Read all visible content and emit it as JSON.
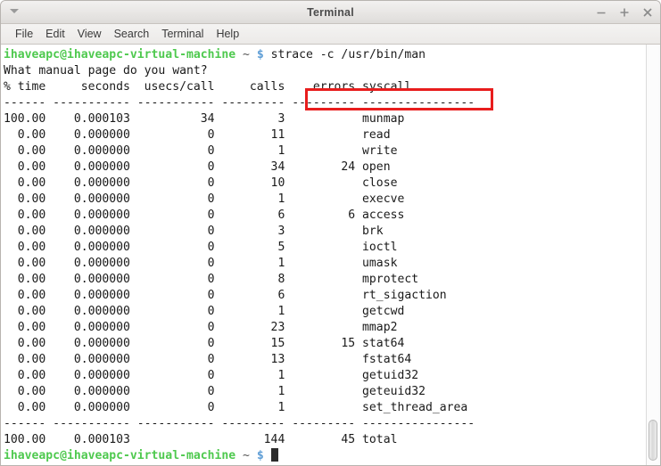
{
  "window": {
    "title": "Terminal",
    "controls": {
      "minimize": "minimize",
      "maximize": "maximize",
      "close": "close"
    }
  },
  "menubar": {
    "items": [
      {
        "label": "File"
      },
      {
        "label": "Edit"
      },
      {
        "label": "View"
      },
      {
        "label": "Search"
      },
      {
        "label": "Terminal"
      },
      {
        "label": "Help"
      }
    ]
  },
  "terminal": {
    "prompt": {
      "user_host": "ihaveapc@ihaveapc-virtual-machine",
      "path": "~",
      "symbol": "$"
    },
    "command": "strace -c /usr/bin/man",
    "command_highlight_color": "#e81d1d",
    "output_first_line": "What manual page do you want?",
    "columns": {
      "header": "% time     seconds  usecs/call     calls    errors syscall",
      "separator": "------ ----------- ----------- --------- --------- ----------------",
      "names": [
        "% time",
        "seconds",
        "usecs/call",
        "calls",
        "errors",
        "syscall"
      ]
    },
    "rows": [
      {
        "time": "100.00",
        "seconds": "0.000103",
        "usecs": "34",
        "calls": "3",
        "errors": "",
        "syscall": "munmap"
      },
      {
        "time": "0.00",
        "seconds": "0.000000",
        "usecs": "0",
        "calls": "11",
        "errors": "",
        "syscall": "read"
      },
      {
        "time": "0.00",
        "seconds": "0.000000",
        "usecs": "0",
        "calls": "1",
        "errors": "",
        "syscall": "write"
      },
      {
        "time": "0.00",
        "seconds": "0.000000",
        "usecs": "0",
        "calls": "34",
        "errors": "24",
        "syscall": "open"
      },
      {
        "time": "0.00",
        "seconds": "0.000000",
        "usecs": "0",
        "calls": "10",
        "errors": "",
        "syscall": "close"
      },
      {
        "time": "0.00",
        "seconds": "0.000000",
        "usecs": "0",
        "calls": "1",
        "errors": "",
        "syscall": "execve"
      },
      {
        "time": "0.00",
        "seconds": "0.000000",
        "usecs": "0",
        "calls": "6",
        "errors": "6",
        "syscall": "access"
      },
      {
        "time": "0.00",
        "seconds": "0.000000",
        "usecs": "0",
        "calls": "3",
        "errors": "",
        "syscall": "brk"
      },
      {
        "time": "0.00",
        "seconds": "0.000000",
        "usecs": "0",
        "calls": "5",
        "errors": "",
        "syscall": "ioctl"
      },
      {
        "time": "0.00",
        "seconds": "0.000000",
        "usecs": "0",
        "calls": "1",
        "errors": "",
        "syscall": "umask"
      },
      {
        "time": "0.00",
        "seconds": "0.000000",
        "usecs": "0",
        "calls": "8",
        "errors": "",
        "syscall": "mprotect"
      },
      {
        "time": "0.00",
        "seconds": "0.000000",
        "usecs": "0",
        "calls": "6",
        "errors": "",
        "syscall": "rt_sigaction"
      },
      {
        "time": "0.00",
        "seconds": "0.000000",
        "usecs": "0",
        "calls": "1",
        "errors": "",
        "syscall": "getcwd"
      },
      {
        "time": "0.00",
        "seconds": "0.000000",
        "usecs": "0",
        "calls": "23",
        "errors": "",
        "syscall": "mmap2"
      },
      {
        "time": "0.00",
        "seconds": "0.000000",
        "usecs": "0",
        "calls": "15",
        "errors": "15",
        "syscall": "stat64"
      },
      {
        "time": "0.00",
        "seconds": "0.000000",
        "usecs": "0",
        "calls": "13",
        "errors": "",
        "syscall": "fstat64"
      },
      {
        "time": "0.00",
        "seconds": "0.000000",
        "usecs": "0",
        "calls": "1",
        "errors": "",
        "syscall": "getuid32"
      },
      {
        "time": "0.00",
        "seconds": "0.000000",
        "usecs": "0",
        "calls": "1",
        "errors": "",
        "syscall": "geteuid32"
      },
      {
        "time": "0.00",
        "seconds": "0.000000",
        "usecs": "0",
        "calls": "1",
        "errors": "",
        "syscall": "set_thread_area"
      }
    ],
    "total": {
      "time": "100.00",
      "seconds": "0.000103",
      "usecs": "",
      "calls": "144",
      "errors": "45",
      "syscall": "total"
    }
  },
  "scrollbar": {
    "position": "bottom"
  }
}
